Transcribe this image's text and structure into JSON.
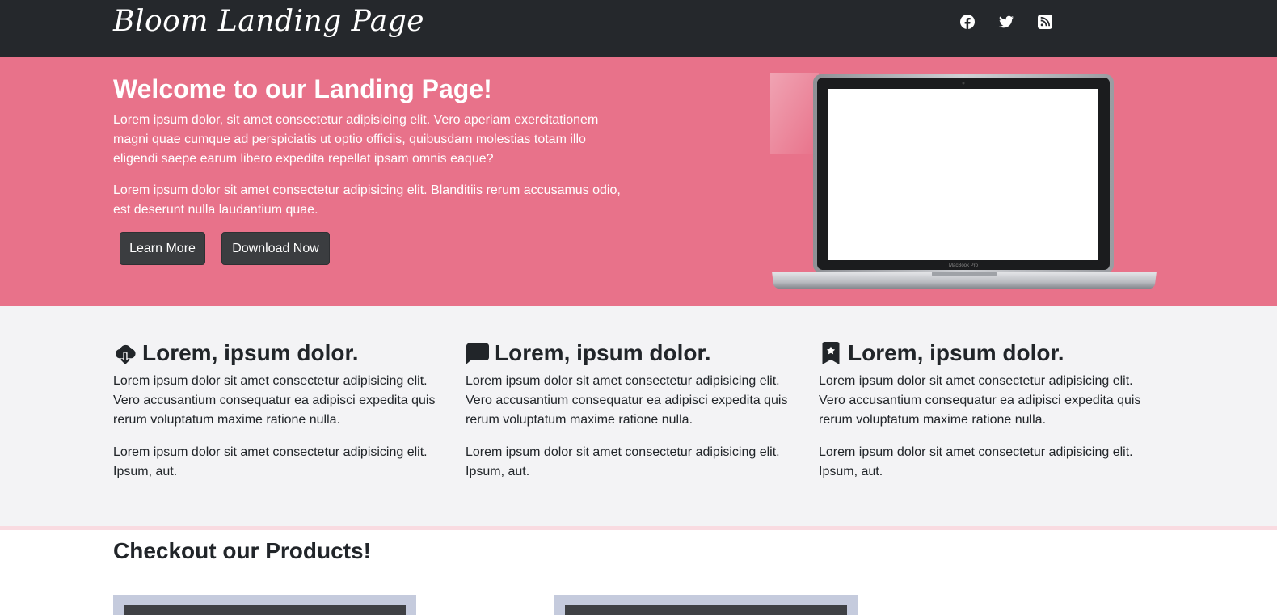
{
  "navbar": {
    "brand": "Bloom Landing Page",
    "social": [
      {
        "name": "facebook-icon"
      },
      {
        "name": "twitter-icon"
      },
      {
        "name": "rss-icon"
      }
    ]
  },
  "hero": {
    "title": "Welcome to our Landing Page!",
    "paragraph1": "Lorem ipsum dolor, sit amet consectetur adipisicing elit. Vero aperiam exercitationem magni quae cumque ad perspiciatis ut optio officiis, quibusdam molestias totam illo eligendi saepe earum libero expedita repellat ipsam omnis eaque?",
    "paragraph2": "Lorem ipsum dolor sit amet consectetur adipisicing elit. Blanditiis rerum accusamus odio, est deserunt nulla laudantium quae.",
    "learn_more": "Learn More",
    "download_now": "Download Now",
    "laptop_label": "MacBook Pro",
    "background_color": "#e8728a"
  },
  "features": [
    {
      "icon": "cloud-download-icon",
      "title": "Lorem, ipsum dolor.",
      "paragraph1": "Lorem ipsum dolor sit amet consectetur adipisicing elit. Vero accusantium consequatur ea adipisci expedita quis rerum voluptatum maxime ratione nulla.",
      "paragraph2": "Lorem ipsum dolor sit amet consectetur adipisicing elit. Ipsum, aut."
    },
    {
      "icon": "chat-square-icon",
      "title": "Lorem, ipsum dolor.",
      "paragraph1": "Lorem ipsum dolor sit amet consectetur adipisicing elit. Vero accusantium consequatur ea adipisci expedita quis rerum voluptatum maxime ratione nulla.",
      "paragraph2": "Lorem ipsum dolor sit amet consectetur adipisicing elit. Ipsum, aut."
    },
    {
      "icon": "bookmark-star-icon",
      "title": "Lorem, ipsum dolor.",
      "paragraph1": "Lorem ipsum dolor sit amet consectetur adipisicing elit. Vero accusantium consequatur ea adipisci expedita quis rerum voluptatum maxime ratione nulla.",
      "paragraph2": "Lorem ipsum dolor sit amet consectetur adipisicing elit. Ipsum, aut."
    }
  ],
  "products": {
    "title": "Checkout our Products!"
  }
}
